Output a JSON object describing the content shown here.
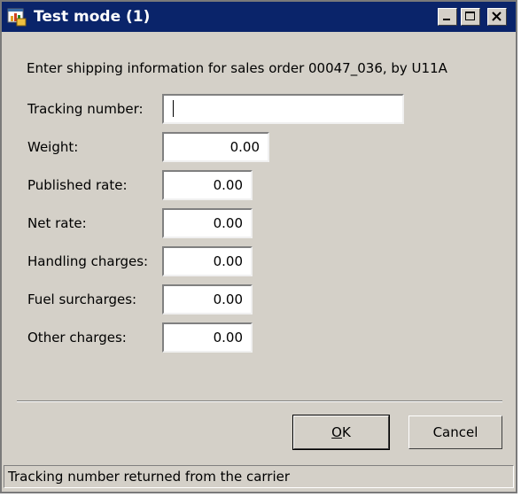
{
  "window": {
    "title": "Test mode (1)",
    "icon": "app-icon",
    "controls": [
      "minimize-icon",
      "maximize-icon",
      "close-icon"
    ]
  },
  "intro": "Enter shipping information for sales order 00047_036, by U11A",
  "fields": {
    "tracking_number": {
      "label": "Tracking number:",
      "value": ""
    },
    "weight": {
      "label": "Weight:",
      "value": "0.00"
    },
    "published_rate": {
      "label": "Published rate:",
      "value": "0.00"
    },
    "net_rate": {
      "label": "Net rate:",
      "value": "0.00"
    },
    "handling_charges": {
      "label": "Handling charges:",
      "value": "0.00"
    },
    "fuel_surcharges": {
      "label": "Fuel surcharges:",
      "value": "0.00"
    },
    "other_charges": {
      "label": "Other charges:",
      "value": "0.00"
    }
  },
  "buttons": {
    "ok_mnemonic": "O",
    "ok_rest": "K",
    "cancel": "Cancel"
  },
  "status": "Tracking number returned from the carrier"
}
